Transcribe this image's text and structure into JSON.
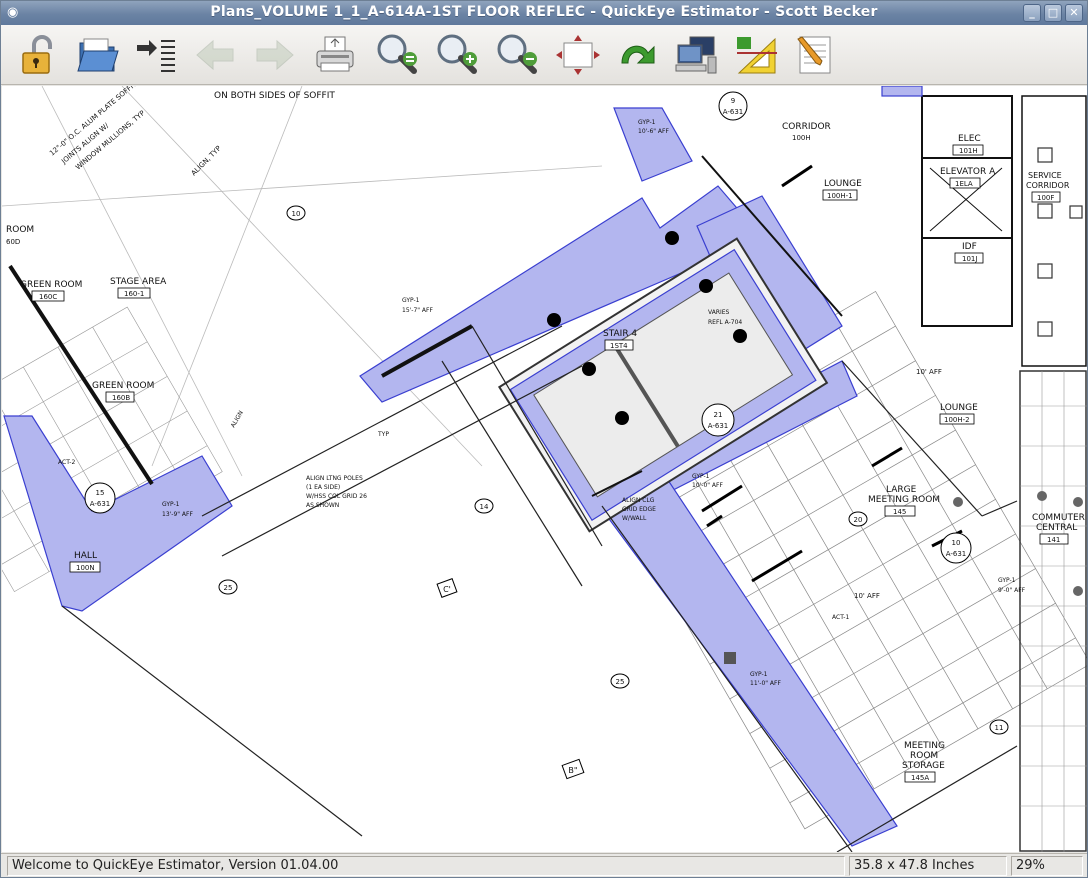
{
  "window": {
    "title": "Plans_VOLUME 1_1_A-614A-1ST FLOOR REFLEC - QuickEye Estimator - Scott Becker",
    "controls": [
      "_",
      "□",
      "✕"
    ]
  },
  "toolbar": {
    "tools": [
      {
        "name": "unlock",
        "icon": "padlock-open-icon",
        "enabled": true
      },
      {
        "name": "open",
        "icon": "folder-open-icon",
        "enabled": true
      },
      {
        "name": "go-to-page",
        "icon": "arrow-list-icon",
        "enabled": true
      },
      {
        "name": "back",
        "icon": "arrow-left-icon",
        "enabled": false
      },
      {
        "name": "forward",
        "icon": "arrow-right-icon",
        "enabled": false
      },
      {
        "name": "print",
        "icon": "printer-icon",
        "enabled": true
      },
      {
        "name": "zoom-fit",
        "icon": "magnifier-equals-icon",
        "enabled": true
      },
      {
        "name": "zoom-in",
        "icon": "magnifier-plus-icon",
        "enabled": true
      },
      {
        "name": "zoom-out",
        "icon": "magnifier-minus-icon",
        "enabled": true
      },
      {
        "name": "pan",
        "icon": "pan-arrows-icon",
        "enabled": true
      },
      {
        "name": "rotate",
        "icon": "rotate-arrow-icon",
        "enabled": true
      },
      {
        "name": "network",
        "icon": "computers-icon",
        "enabled": true
      },
      {
        "name": "scale",
        "icon": "triangle-ruler-icon",
        "enabled": true
      },
      {
        "name": "notes",
        "icon": "pencil-note-icon",
        "enabled": true
      }
    ]
  },
  "drawing": {
    "labels": {
      "soffit_note": "ON BOTH SIDES OF SOFFIT",
      "plate_note_1": "12\"-0\" O.C. ALUM PLATE SOFFIT",
      "plate_note_2": "JOINTS ALIGN W/",
      "plate_note_3": "WINDOW MULLIONS, TYP",
      "align_typ": "ALIGN, TYP",
      "room_cut": "ROOM",
      "room_cut_num": "60D",
      "green_room_1": "GREEN ROOM",
      "green_room_1_num": "160C",
      "stage_area": "STAGE AREA",
      "stage_area_num": "160-1",
      "green_room_2": "GREEN ROOM",
      "green_room_2_num": "160B",
      "hall": "HALL",
      "hall_num": "100N",
      "stair": "STAIR 4",
      "stair_num": "1ST4",
      "corridor": "CORRIDOR",
      "corridor_num": "100H",
      "lounge_1": "LOUNGE",
      "lounge_1_num": "100H-1",
      "lounge_2": "LOUNGE",
      "lounge_2_num": "100H-2",
      "elec": "ELEC",
      "elec_num": "101H",
      "elevator": "ELEVATOR A",
      "elevator_num": "1ELA",
      "idf": "IDF",
      "idf_num": "101J",
      "service_corridor_1": "SERVICE",
      "service_corridor_2": "CORRIDOR",
      "service_corridor_num": "100F",
      "large_meeting_1": "LARGE",
      "large_meeting_2": "MEETING ROOM",
      "large_meeting_num": "145",
      "commuter_1": "COMMUTER",
      "commuter_2": "CENTRAL",
      "commuter_num": "141",
      "meeting_storage_1": "MEETING",
      "meeting_storage_2": "ROOM",
      "meeting_storage_3": "STORAGE",
      "meeting_storage_num": "145A",
      "gyp_1": "GYP-1",
      "gyp_15_7": "15'-7\" AFF",
      "gyp_10_6": "10'-6\" AFF",
      "gyp_13_9": "13'-9\" AFF",
      "gyp_11_0": "11'-0\" AFF",
      "gyp_9_0": "9'-0\" AFF",
      "gyp_10_0": "10'-0\" AFF",
      "act_2": "ACT-2",
      "act_1": "ACT-1",
      "aff_10": "10' AFF",
      "aff_10b": "10'  AFF",
      "varies": "VARIES",
      "refl": "REFL A-704",
      "align_poles_1": "ALIGN LTNG POLES",
      "align_poles_2": "(1 EA SIDE)",
      "align_poles_3": "W/HSS COL GRID 26",
      "align_poles_4": "AS SHOWN",
      "align_grid_1": "ALIGN CLG",
      "align_grid_2": "GRID EDGE",
      "align_grid_3": "W/WALL",
      "typ": "TYP",
      "align": "ALIGN",
      "tag_9": "9",
      "tag_a631a": "A-631",
      "tag_15": "15",
      "tag_a631b": "A-631",
      "tag_21": "21",
      "tag_a631c": "A-631",
      "tag_10": "10",
      "tag_a631d": "A-631",
      "grid_10": "10",
      "grid_14": "14",
      "grid_25a": "25",
      "grid_25b": "25",
      "grid_20": "20",
      "grid_11": "11",
      "grid_c": "C'",
      "grid_b": "B\""
    }
  },
  "status": {
    "message": "Welcome to QuickEye Estimator, Version 01.04.00",
    "dimensions": "35.8 x 47.8 Inches",
    "zoom": "29%"
  }
}
